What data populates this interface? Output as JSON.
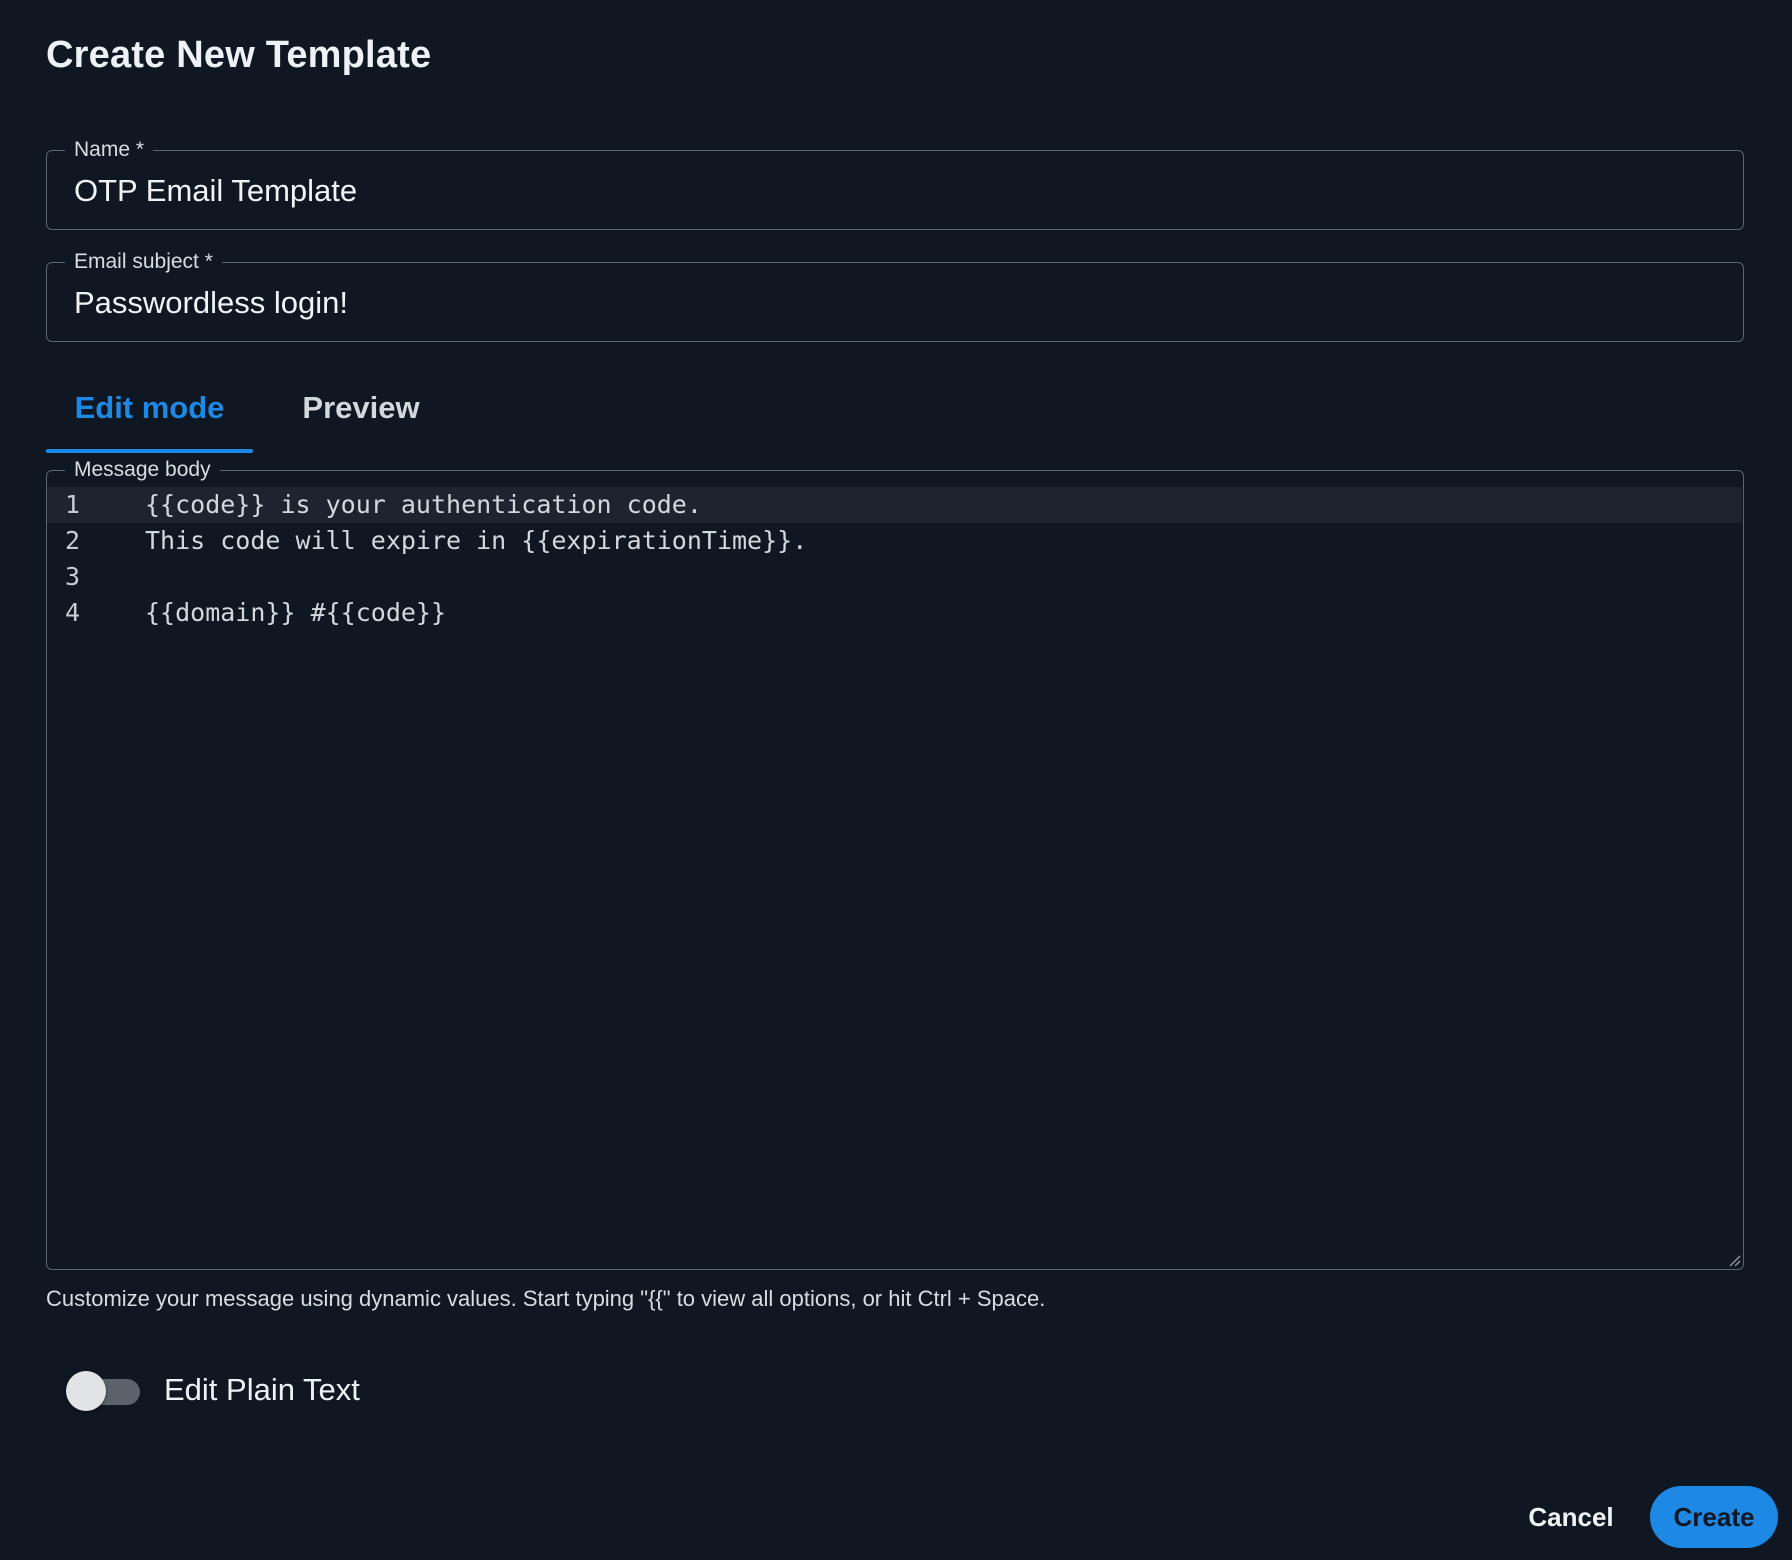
{
  "dialog": {
    "title": "Create New Template"
  },
  "form": {
    "name_label": "Name *",
    "name_value": "OTP Email Template",
    "subject_label": "Email subject *",
    "subject_value": "Passwordless login!"
  },
  "tabs": [
    {
      "label": "Edit mode",
      "active": true
    },
    {
      "label": "Preview",
      "active": false
    }
  ],
  "editor": {
    "label": "Message body",
    "lines": [
      {
        "num": "1",
        "text": "{{code}} is your authentication code."
      },
      {
        "num": "2",
        "text": "This code will expire in {{expirationTime}}."
      },
      {
        "num": "3",
        "text": ""
      },
      {
        "num": "4",
        "text": "{{domain}} #{{code}}"
      }
    ],
    "helper": "Customize your message using dynamic values. Start typing \"{{\" to view all options, or hit Ctrl + Space."
  },
  "toggle": {
    "label": "Edit Plain Text",
    "checked": false
  },
  "actions": {
    "cancel_label": "Cancel",
    "create_label": "Create"
  },
  "colors": {
    "background": "#0f1722",
    "accent": "#1e88e5",
    "border": "#5a6472"
  }
}
